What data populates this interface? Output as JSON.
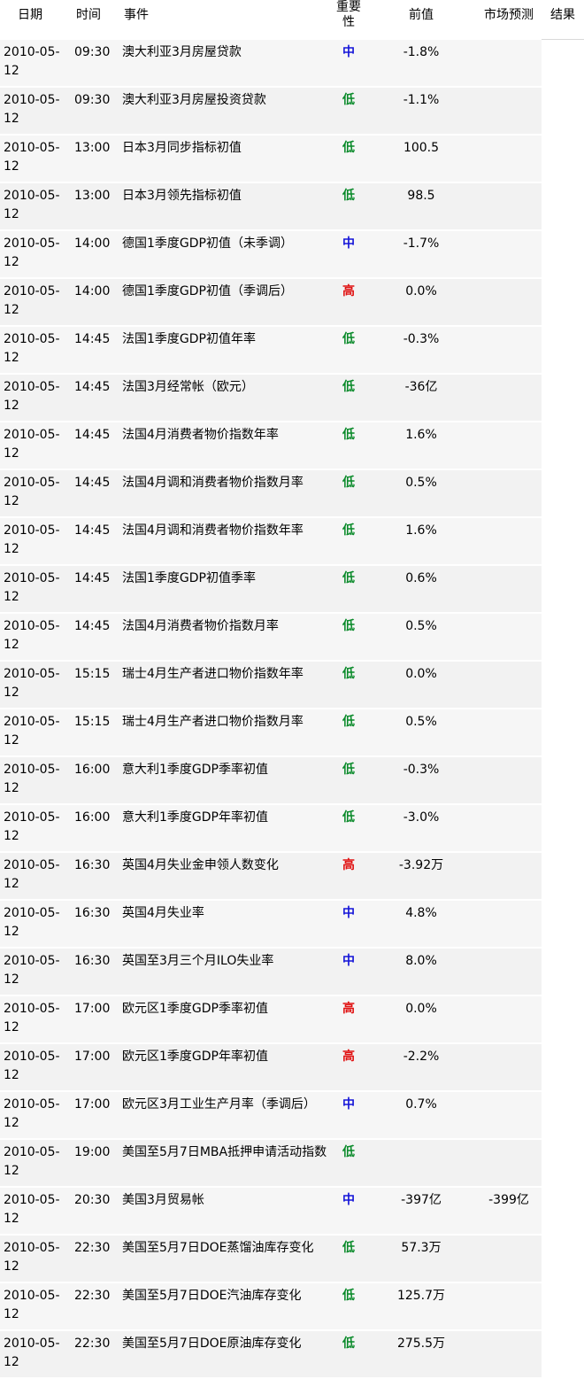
{
  "headers": {
    "date": "日期",
    "time": "时间",
    "event": "事件",
    "importance": "重要性",
    "previous": "前值",
    "forecast": "市场预测",
    "result": "结果"
  },
  "colors": {
    "low": "#0a8a2a",
    "mid": "#1414d8",
    "high": "#e01010"
  },
  "rows": [
    {
      "date": "2010-05-12",
      "time": "09:30",
      "event": "澳大利亚3月房屋贷款",
      "importance": "中",
      "level": "mid",
      "previous": "-1.8%",
      "forecast": "",
      "result": ""
    },
    {
      "date": "2010-05-12",
      "time": "09:30",
      "event": "澳大利亚3月房屋投资贷款",
      "importance": "低",
      "level": "low",
      "previous": "-1.1%",
      "forecast": "",
      "result": ""
    },
    {
      "date": "2010-05-12",
      "time": "13:00",
      "event": "日本3月同步指标初值",
      "importance": "低",
      "level": "low",
      "previous": "100.5",
      "forecast": "",
      "result": ""
    },
    {
      "date": "2010-05-12",
      "time": "13:00",
      "event": "日本3月领先指标初值",
      "importance": "低",
      "level": "low",
      "previous": "98.5",
      "forecast": "",
      "result": ""
    },
    {
      "date": "2010-05-12",
      "time": "14:00",
      "event": "德国1季度GDP初值（未季调）",
      "importance": "中",
      "level": "mid",
      "previous": "-1.7%",
      "forecast": "",
      "result": ""
    },
    {
      "date": "2010-05-12",
      "time": "14:00",
      "event": "德国1季度GDP初值（季调后）",
      "importance": "高",
      "level": "high",
      "previous": "0.0%",
      "forecast": "",
      "result": ""
    },
    {
      "date": "2010-05-12",
      "time": "14:45",
      "event": "法国1季度GDP初值年率",
      "importance": "低",
      "level": "low",
      "previous": "-0.3%",
      "forecast": "",
      "result": ""
    },
    {
      "date": "2010-05-12",
      "time": "14:45",
      "event": "法国3月经常帐（欧元）",
      "importance": "低",
      "level": "low",
      "previous": "-36亿",
      "forecast": "",
      "result": ""
    },
    {
      "date": "2010-05-12",
      "time": "14:45",
      "event": "法国4月消费者物价指数年率",
      "importance": "低",
      "level": "low",
      "previous": "1.6%",
      "forecast": "",
      "result": ""
    },
    {
      "date": "2010-05-12",
      "time": "14:45",
      "event": "法国4月调和消费者物价指数月率",
      "importance": "低",
      "level": "low",
      "previous": "0.5%",
      "forecast": "",
      "result": ""
    },
    {
      "date": "2010-05-12",
      "time": "14:45",
      "event": "法国4月调和消费者物价指数年率",
      "importance": "低",
      "level": "low",
      "previous": "1.6%",
      "forecast": "",
      "result": ""
    },
    {
      "date": "2010-05-12",
      "time": "14:45",
      "event": "法国1季度GDP初值季率",
      "importance": "低",
      "level": "low",
      "previous": "0.6%",
      "forecast": "",
      "result": ""
    },
    {
      "date": "2010-05-12",
      "time": "14:45",
      "event": "法国4月消费者物价指数月率",
      "importance": "低",
      "level": "low",
      "previous": "0.5%",
      "forecast": "",
      "result": ""
    },
    {
      "date": "2010-05-12",
      "time": "15:15",
      "event": "瑞士4月生产者进口物价指数年率",
      "importance": "低",
      "level": "low",
      "previous": "0.0%",
      "forecast": "",
      "result": ""
    },
    {
      "date": "2010-05-12",
      "time": "15:15",
      "event": "瑞士4月生产者进口物价指数月率",
      "importance": "低",
      "level": "low",
      "previous": "0.5%",
      "forecast": "",
      "result": ""
    },
    {
      "date": "2010-05-12",
      "time": "16:00",
      "event": "意大利1季度GDP季率初值",
      "importance": "低",
      "level": "low",
      "previous": "-0.3%",
      "forecast": "",
      "result": ""
    },
    {
      "date": "2010-05-12",
      "time": "16:00",
      "event": "意大利1季度GDP年率初值",
      "importance": "低",
      "level": "low",
      "previous": "-3.0%",
      "forecast": "",
      "result": ""
    },
    {
      "date": "2010-05-12",
      "time": "16:30",
      "event": "英国4月失业金申领人数变化",
      "importance": "高",
      "level": "high",
      "previous": "-3.92万",
      "forecast": "",
      "result": ""
    },
    {
      "date": "2010-05-12",
      "time": "16:30",
      "event": "英国4月失业率",
      "importance": "中",
      "level": "mid",
      "previous": "4.8%",
      "forecast": "",
      "result": ""
    },
    {
      "date": "2010-05-12",
      "time": "16:30",
      "event": "英国至3月三个月ILO失业率",
      "importance": "中",
      "level": "mid",
      "previous": "8.0%",
      "forecast": "",
      "result": ""
    },
    {
      "date": "2010-05-12",
      "time": "17:00",
      "event": "欧元区1季度GDP季率初值",
      "importance": "高",
      "level": "high",
      "previous": "0.0%",
      "forecast": "",
      "result": ""
    },
    {
      "date": "2010-05-12",
      "time": "17:00",
      "event": "欧元区1季度GDP年率初值",
      "importance": "高",
      "level": "high",
      "previous": "-2.2%",
      "forecast": "",
      "result": ""
    },
    {
      "date": "2010-05-12",
      "time": "17:00",
      "event": "欧元区3月工业生产月率（季调后）",
      "importance": "中",
      "level": "mid",
      "previous": "0.7%",
      "forecast": "",
      "result": ""
    },
    {
      "date": "2010-05-12",
      "time": "19:00",
      "event": "美国至5月7日MBA抵押申请活动指数",
      "importance": "低",
      "level": "low",
      "previous": "",
      "forecast": "",
      "result": ""
    },
    {
      "date": "2010-05-12",
      "time": "20:30",
      "event": "美国3月贸易帐",
      "importance": "中",
      "level": "mid",
      "previous": "-397亿",
      "forecast": "-399亿",
      "result": ""
    },
    {
      "date": "2010-05-12",
      "time": "22:30",
      "event": "美国至5月7日DOE蒸馏油库存变化",
      "importance": "低",
      "level": "low",
      "previous": "57.3万",
      "forecast": "",
      "result": ""
    },
    {
      "date": "2010-05-12",
      "time": "22:30",
      "event": "美国至5月7日DOE汽油库存变化",
      "importance": "低",
      "level": "low",
      "previous": "125.7万",
      "forecast": "",
      "result": ""
    },
    {
      "date": "2010-05-12",
      "time": "22:30",
      "event": "美国至5月7日DOE原油库存变化",
      "importance": "低",
      "level": "low",
      "previous": "275.5万",
      "forecast": "",
      "result": ""
    }
  ]
}
